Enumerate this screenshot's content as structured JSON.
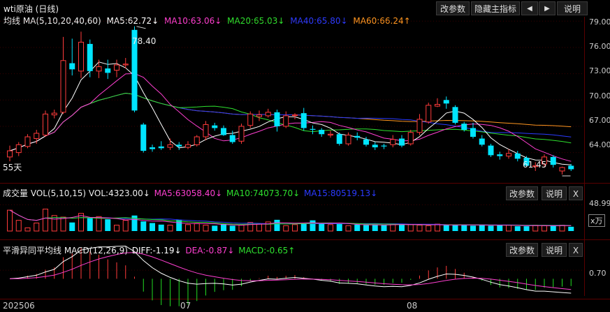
{
  "colors": {
    "up": "#ff3b3b",
    "down": "#00e5ff",
    "ma5": "#ffffff",
    "ma10": "#ff3fd1",
    "ma20": "#2ee02e",
    "ma40": "#2b3bff",
    "ma60": "#ff9620",
    "macd_pos": "#ff3b3b",
    "macd_neg": "#22dd22"
  },
  "header": {
    "title": "wti原油 (日线)",
    "btn_params": "改参数",
    "btn_hide": "隐藏主指标",
    "btn_left": "◀",
    "btn_right": "▶",
    "btn_help": "说明"
  },
  "ma_bar": {
    "label": "均线 MA(5,10,20,40,60)",
    "ma5": "MA5:62.72↓",
    "ma10": "MA10:63.06↓",
    "ma20": "MA20:65.03↓",
    "ma40": "MA40:65.80↓",
    "ma60": "MA60:66.24↑"
  },
  "price_axis": [
    "79.00",
    "76.00",
    "73.00",
    "70.00",
    "67.00",
    "64.00"
  ],
  "annotations": {
    "high": "78.40",
    "low": "61.45",
    "days": "55天"
  },
  "volume": {
    "label": "成交量 VOL(5,10,15) VOL:4323.00↓",
    "ma5": "MA5:63058.40↓",
    "ma10": "MA10:74073.70↓",
    "ma15": "MA15:80519.13↓",
    "axis": "48.99",
    "unit": "x万",
    "btn_params": "改参数",
    "btn_help": "说明",
    "btn_close": "X"
  },
  "macd": {
    "label": "平滑异同平均线 MACD(12,26,9)",
    "diff": "DIFF:-1.19↓",
    "dea": "DEA:-0.87↓",
    "macd": "MACD:-0.65↑",
    "axis": "0.70",
    "btn_params": "改参数",
    "btn_help": "说明",
    "btn_close": "X"
  },
  "x_axis": [
    "202506",
    "07",
    "08"
  ],
  "chart_data": {
    "type": "candlestick",
    "price_range": [
      61.5,
      79.5
    ],
    "candles": [
      [
        63.5,
        64.2,
        63.0,
        64.8
      ],
      [
        64.0,
        64.9,
        63.6,
        65.2
      ],
      [
        64.7,
        65.8,
        64.5,
        66.1
      ],
      [
        65.6,
        66.2,
        65.0,
        66.6
      ],
      [
        66.0,
        68.4,
        65.8,
        68.8
      ],
      [
        68.3,
        68.5,
        67.9,
        68.9
      ],
      [
        68.6,
        74.5,
        68.4,
        77.2
      ],
      [
        74.2,
        73.5,
        72.8,
        77.0
      ],
      [
        73.3,
        76.6,
        72.5,
        77.8
      ],
      [
        76.4,
        73.3,
        72.6,
        76.9
      ],
      [
        73.3,
        73.8,
        72.5,
        74.6
      ],
      [
        73.6,
        73.1,
        72.4,
        74.6
      ],
      [
        73.4,
        74.0,
        72.6,
        74.6
      ],
      [
        74.0,
        74.1,
        73.6,
        74.8
      ],
      [
        78.0,
        68.8,
        68.6,
        78.4
      ],
      [
        67.2,
        64.2,
        64.0,
        67.4
      ],
      [
        64.6,
        64.4,
        64.1,
        64.9
      ],
      [
        64.7,
        64.5,
        64.3,
        65.3
      ],
      [
        64.6,
        64.9,
        64.3,
        65.6
      ],
      [
        64.9,
        64.7,
        64.3,
        65.2
      ],
      [
        64.6,
        64.9,
        64.4,
        65.3
      ],
      [
        64.9,
        65.8,
        64.7,
        66.0
      ],
      [
        65.8,
        67.2,
        65.4,
        67.6
      ],
      [
        67.1,
        66.8,
        66.5,
        67.4
      ],
      [
        66.8,
        66.0,
        65.9,
        67.1
      ],
      [
        66.0,
        65.2,
        65.0,
        66.5
      ],
      [
        65.3,
        67.0,
        65.0,
        67.3
      ],
      [
        67.1,
        68.4,
        66.8,
        68.7
      ],
      [
        68.1,
        68.3,
        67.6,
        68.8
      ],
      [
        68.2,
        68.6,
        68.0,
        69.0
      ],
      [
        68.6,
        67.0,
        66.4,
        68.9
      ],
      [
        67.0,
        68.2,
        66.8,
        68.7
      ],
      [
        68.3,
        68.3,
        67.8,
        68.5
      ],
      [
        68.5,
        66.8,
        66.5,
        69.1
      ],
      [
        66.7,
        66.6,
        66.1,
        67.1
      ],
      [
        66.6,
        66.1,
        65.8,
        66.8
      ],
      [
        66.0,
        66.1,
        65.7,
        66.5
      ],
      [
        66.1,
        65.0,
        64.8,
        66.3
      ],
      [
        65.0,
        66.0,
        64.8,
        66.3
      ],
      [
        65.9,
        65.7,
        65.4,
        66.3
      ],
      [
        65.5,
        64.9,
        64.7,
        65.8
      ],
      [
        64.9,
        64.6,
        64.3,
        65.2
      ],
      [
        64.8,
        64.7,
        64.4,
        65.0
      ],
      [
        64.9,
        65.5,
        64.6,
        66.0
      ],
      [
        65.6,
        64.8,
        64.6,
        66.0
      ],
      [
        65.0,
        66.3,
        64.8,
        66.6
      ],
      [
        66.3,
        67.8,
        66.0,
        68.4
      ],
      [
        67.5,
        69.4,
        67.3,
        69.7
      ],
      [
        69.3,
        69.5,
        69.2,
        70.2
      ],
      [
        70.0,
        69.6,
        69.0,
        70.4
      ],
      [
        69.2,
        67.4,
        67.2,
        69.4
      ],
      [
        67.3,
        66.6,
        66.4,
        67.5
      ],
      [
        66.8,
        65.8,
        65.6,
        67.4
      ],
      [
        65.6,
        64.9,
        64.7,
        66.0
      ],
      [
        64.8,
        63.7,
        63.5,
        65.0
      ],
      [
        63.8,
        63.6,
        63.2,
        64.1
      ],
      [
        63.6,
        63.9,
        63.3,
        64.4
      ],
      [
        63.9,
        63.3,
        63.0,
        64.2
      ],
      [
        63.4,
        62.5,
        62.4,
        63.6
      ],
      [
        62.4,
        62.5,
        61.9,
        62.9
      ],
      [
        62.7,
        63.5,
        62.4,
        63.8
      ],
      [
        63.5,
        62.6,
        62.3,
        63.7
      ],
      [
        61.9,
        62.3,
        61.5,
        62.4
      ],
      [
        62.5,
        62.1,
        61.9,
        62.7
      ]
    ],
    "volume": [
      3.9,
      2.0,
      0.6,
      1.5,
      4.1,
      2.9,
      2.6,
      1.6,
      3.3,
      2.4,
      2.7,
      2.2,
      1.1,
      2.0,
      2.9,
      1.8,
      1.5,
      1.2,
      1.1,
      2.1,
      1.2,
      1.4,
      1.1,
      1.0,
      1.3,
      1.0,
      1.1,
      1.6,
      1.3,
      1.7,
      2.1,
      1.0,
      1.2,
      1.5,
      2.0,
      1.5,
      1.2,
      1.3,
      1.0,
      1.2,
      1.1,
      1.2,
      1.1,
      1.3,
      1.3,
      1.2,
      1.1,
      1.0,
      1.3,
      1.1,
      1.1,
      1.2,
      1.0,
      1.2,
      1.0,
      1.1,
      1.1,
      0.9,
      0.9,
      1.1,
      1.0,
      1.0,
      1.1,
      0.8
    ],
    "volume_range": [
      0,
      6
    ],
    "macd_range": [
      -1.4,
      1.9
    ]
  }
}
